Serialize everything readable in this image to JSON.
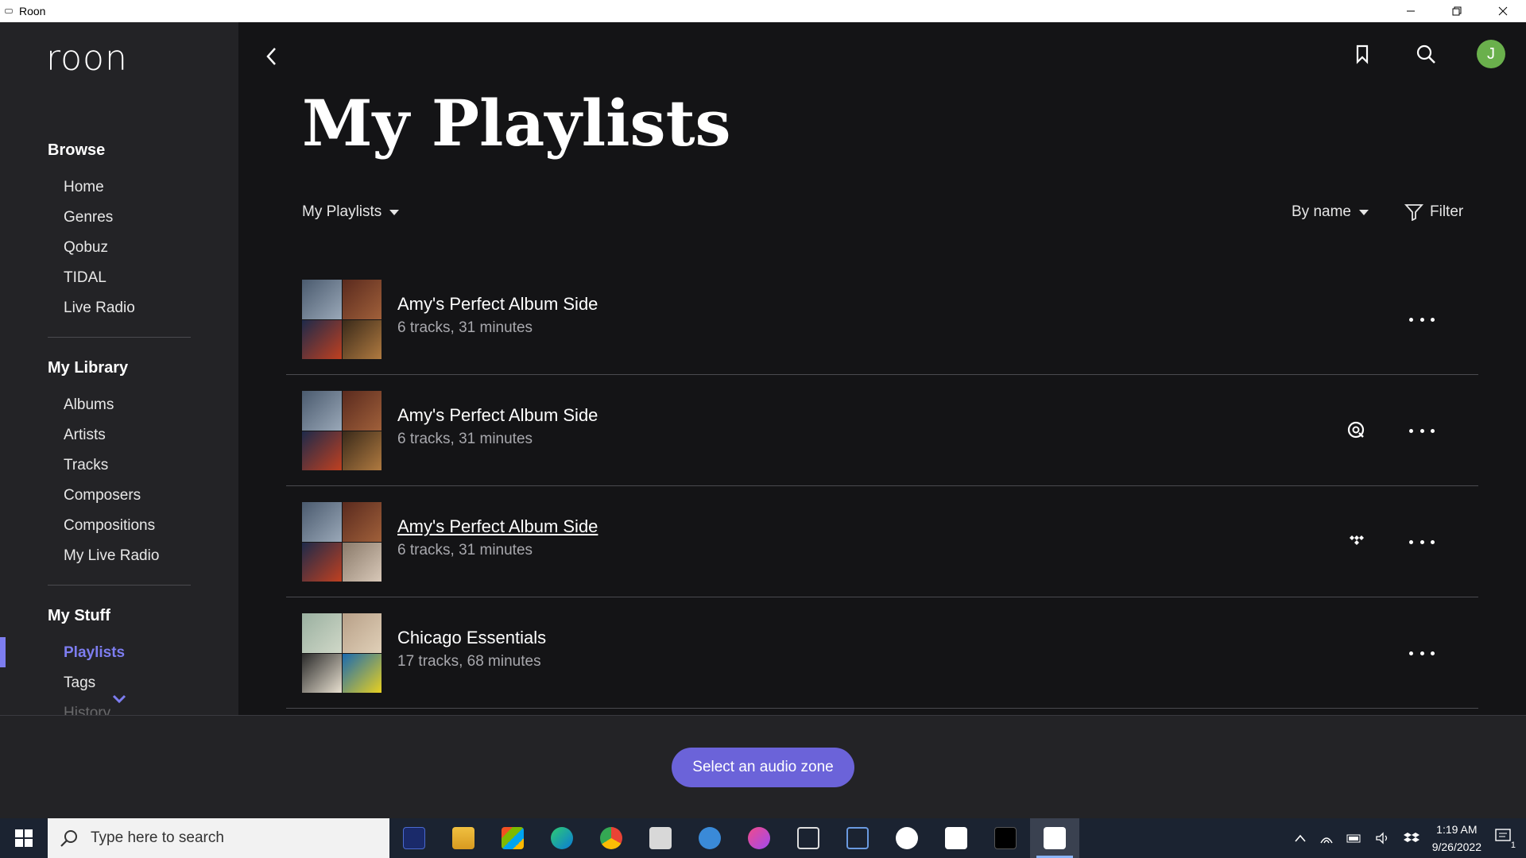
{
  "window": {
    "title": "Roon"
  },
  "sidebar": {
    "logo": "roon",
    "sections": [
      {
        "title": "Browse",
        "items": [
          "Home",
          "Genres",
          "Qobuz",
          "TIDAL",
          "Live Radio"
        ]
      },
      {
        "title": "My Library",
        "items": [
          "Albums",
          "Artists",
          "Tracks",
          "Composers",
          "Compositions",
          "My Live Radio"
        ]
      },
      {
        "title": "My Stuff",
        "items": [
          "Playlists",
          "Tags",
          "History"
        ]
      }
    ],
    "active_item": "Playlists"
  },
  "header": {
    "page_title": "My Playlists",
    "avatar_initial": "J",
    "icons": [
      "back-icon",
      "bookmark-icon",
      "search-icon"
    ]
  },
  "toolbar": {
    "view_selector": "My Playlists",
    "sort_selector": "By name",
    "filter_label": "Filter"
  },
  "playlists": [
    {
      "title": "Amy's Perfect Album Side",
      "subtitle": "6 tracks, 31 minutes",
      "service_icon": ""
    },
    {
      "title": "Amy's Perfect Album Side",
      "subtitle": "6 tracks, 31 minutes",
      "service_icon": "qobuz-icon"
    },
    {
      "title": "Amy's Perfect Album Side",
      "subtitle": "6 tracks, 31 minutes",
      "service_icon": "tidal-icon"
    },
    {
      "title": "Chicago Essentials",
      "subtitle": "17 tracks, 68 minutes",
      "service_icon": ""
    }
  ],
  "bottom_bar": {
    "zone_button": "Select an audio zone"
  },
  "taskbar": {
    "search_placeholder": "Type here to search",
    "time": "1:19 AM",
    "date": "9/26/2022",
    "notification_count": "1"
  },
  "colors": {
    "accent": "#7d7df0",
    "zone_button": "#6b63d9",
    "avatar": "#6ab04c",
    "background": "#141416",
    "sidebar": "#232326"
  }
}
